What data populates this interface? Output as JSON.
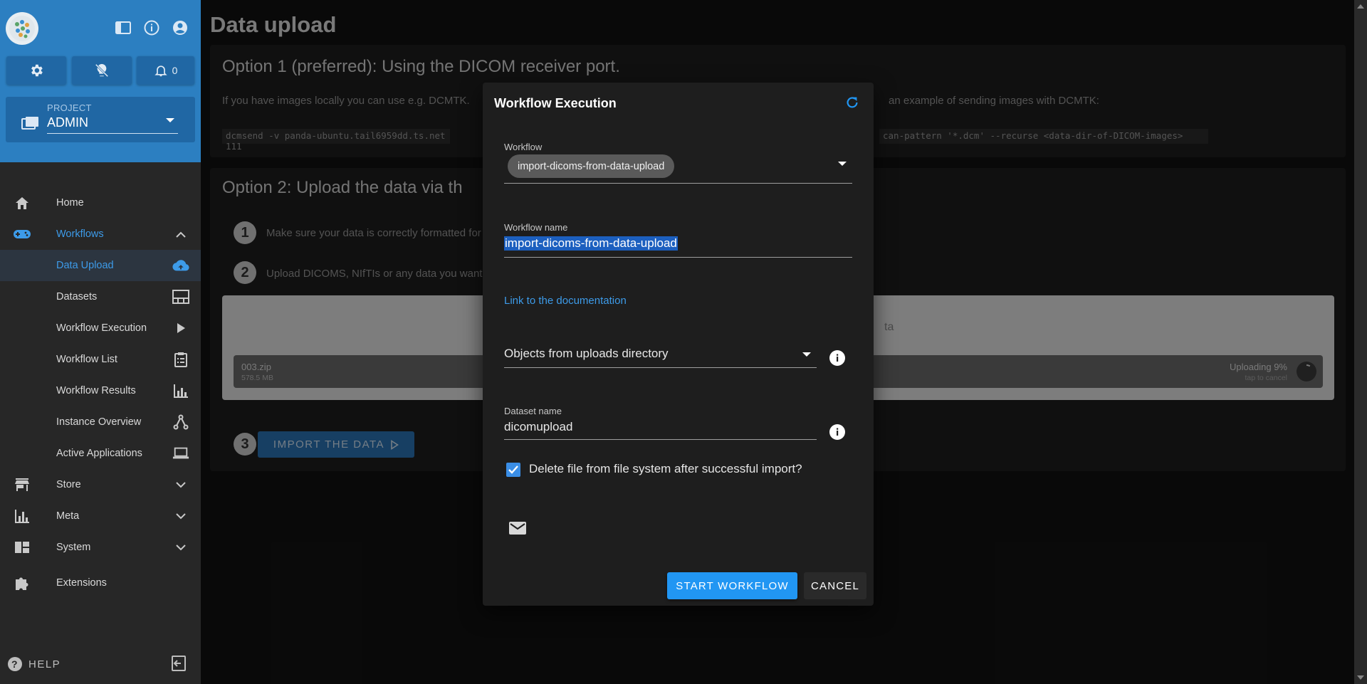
{
  "colors": {
    "accent": "#2196f3",
    "sidebar_top": "#2c7fc1",
    "background": "#121212"
  },
  "header": {
    "notification_count": "0"
  },
  "project": {
    "label": "PROJECT",
    "value": "ADMIN"
  },
  "nav": {
    "home": "Home",
    "workflows": "Workflows",
    "data_upload": "Data Upload",
    "datasets": "Datasets",
    "workflow_execution": "Workflow Execution",
    "workflow_list": "Workflow List",
    "workflow_results": "Workflow Results",
    "instance_overview": "Instance Overview",
    "active_applications": "Active Applications",
    "store": "Store",
    "meta": "Meta",
    "system": "System",
    "extensions": "Extensions",
    "help": "HELP"
  },
  "page": {
    "title": "Data upload",
    "option1_title": "Option 1 (preferred): Using the DICOM receiver port.",
    "option1_text_left": "If you have images locally you can use e.g. DCMTK.",
    "option1_text_right": "an example of sending images with DCMTK:",
    "code_left": "dcmsend -v panda-ubuntu.tail6959dd.ts.net 111",
    "code_right": "can-pattern '*.dcm' --recurse <data-dir-of-DICOM-images>",
    "option2_title": "Option 2: Upload the data via th",
    "step1": "Make sure your data is correctly formatted for",
    "step2": "Upload DICOMS, NIfTIs or any data you want",
    "dropzone_text": "ta",
    "file_name": "003.zip",
    "file_size": "578.5 MB",
    "upload_status": "Uploading 9%",
    "upload_progress": 0.09,
    "tap_cancel": "tap to cancel",
    "import_button": "IMPORT THE DATA"
  },
  "dialog": {
    "title": "Workflow Execution",
    "workflow_label": "Workflow",
    "workflow_chip": "import-dicoms-from-data-upload",
    "workflow_name_label": "Workflow name",
    "workflow_name_value": "import-dicoms-from-data-upload",
    "doc_link": "Link to the documentation",
    "objects_select": "Objects from uploads directory",
    "dataset_label": "Dataset name",
    "dataset_value": "dicomupload",
    "delete_checkbox": "Delete file from file system after successful import?",
    "delete_checked": true,
    "start_button": "START WORKFLOW",
    "cancel_button": "CANCEL"
  }
}
